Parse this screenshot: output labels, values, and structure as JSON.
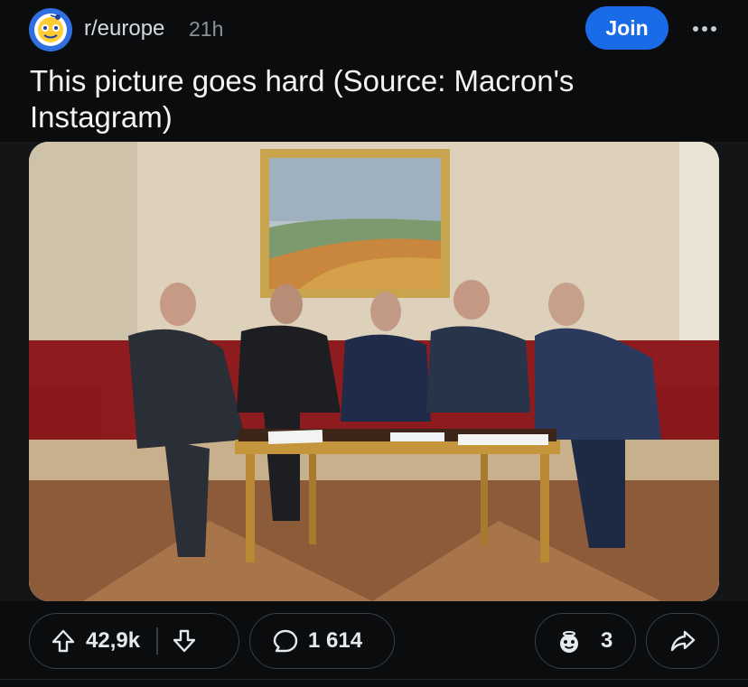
{
  "post": {
    "subreddit": "r/europe",
    "age": "21h",
    "join_label": "Join",
    "title": "This picture goes hard (Source: Macron's Instagram)"
  },
  "image": {
    "subject": "five-men-around-coffee-table-photo"
  },
  "actions": {
    "score": "42,9k",
    "comments": "1 614",
    "awards": "3"
  },
  "icons": [
    "subreddit-avatar-icon",
    "more-icon",
    "upvote-icon",
    "downvote-icon",
    "comment-icon",
    "award-icon",
    "share-icon"
  ],
  "colors": {
    "accent": "#1a6be8",
    "background": "#0b0c0d",
    "pill_border": "#3a3f44"
  }
}
